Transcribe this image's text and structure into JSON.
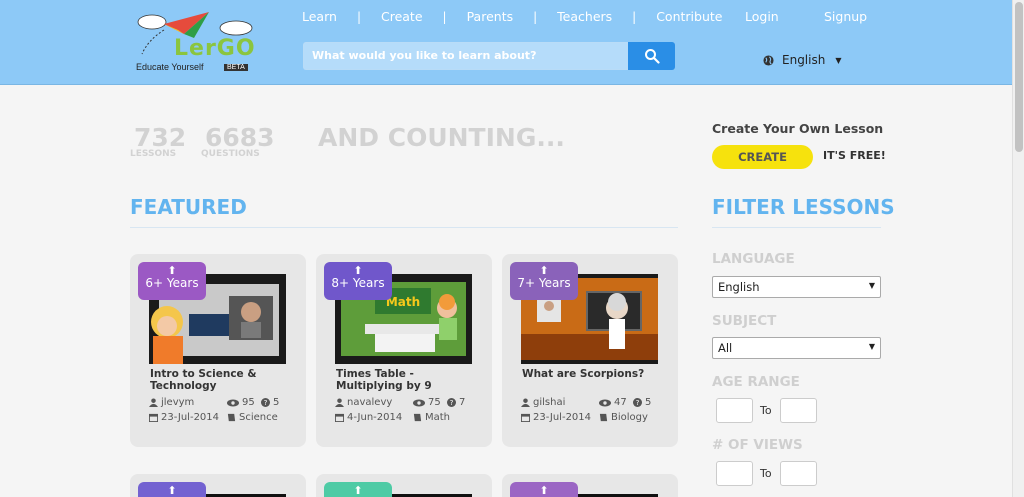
{
  "header": {
    "logo_text": "LerGO",
    "logo_tagline": "Educate Yourself",
    "logo_beta": "BETA",
    "nav": [
      "Learn",
      "Create",
      "Parents",
      "Teachers",
      "Contribute"
    ],
    "nav_separator": "|",
    "search_placeholder": "What would you like to learn about?",
    "login": "Login",
    "signup": "Signup",
    "language": "English",
    "language_caret": "▼"
  },
  "stats": {
    "lessons_count": "732",
    "lessons_label": "LESSONS",
    "questions_count": "6683",
    "questions_label": "QUESTIONS",
    "counting": "AND COUNTING..."
  },
  "featured": {
    "title": "FEATURED",
    "cards": [
      {
        "age": "6+ Years",
        "age_color": "#9b59c4",
        "title": "Intro to Science & Technology",
        "author": "jlevym",
        "views": "95",
        "questions": "5",
        "date": "23-Jul-2014",
        "subject": "Science"
      },
      {
        "age": "8+ Years",
        "age_color": "#7057cb",
        "title": "Times Table - Multiplying by 9",
        "author": "navalevy",
        "views": "75",
        "questions": "7",
        "date": "4-Jun-2014",
        "subject": "Math"
      },
      {
        "age": "7+ Years",
        "age_color": "#8a62ba",
        "title": "What are Scorpions?",
        "author": "gilshai",
        "views": "47",
        "questions": "5",
        "date": "23-Jul-2014",
        "subject": "Biology"
      }
    ],
    "next_row_colors": [
      "#7362d1",
      "#4ecba5",
      "#9b66c4"
    ]
  },
  "sidebar": {
    "create_title": "Create Your Own Lesson",
    "create_button": "CREATE",
    "free_text": "IT'S FREE!",
    "filter_title": "FILTER LESSONS",
    "language_label": "LANGUAGE",
    "language_value": "English",
    "subject_label": "SUBJECT",
    "subject_value": "All",
    "age_label": "AGE RANGE",
    "views_label": "# OF VIEWS",
    "to_label": "To",
    "select_caret": "▼"
  },
  "colors": {
    "header_bg": "#8dc9f7",
    "accent_blue": "#62b4ef",
    "search_button": "#2a8ee6",
    "create_yellow": "#f6e20d"
  }
}
